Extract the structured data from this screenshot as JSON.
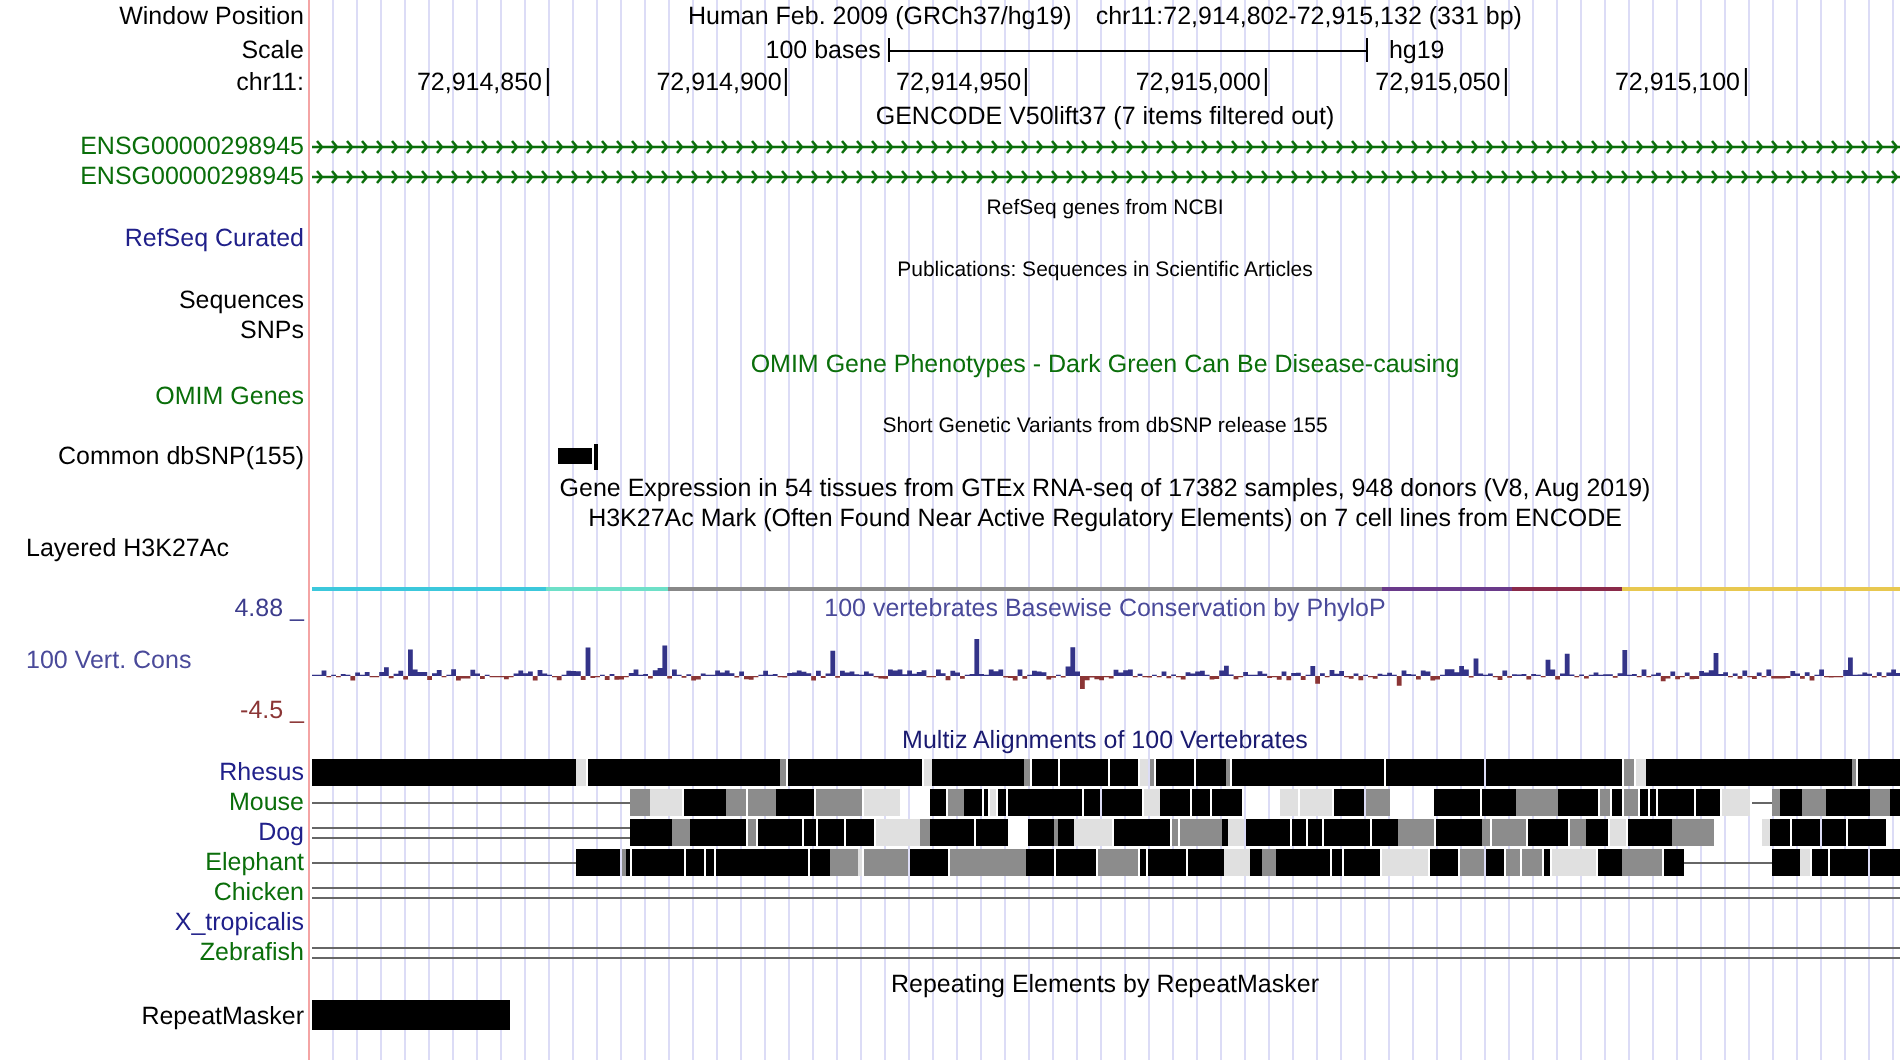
{
  "header": {
    "window_position_label": "Window Position",
    "assembly": "Human Feb. 2009 (GRCh37/hg19)",
    "position": "chr11:72,914,802-72,915,132 (331 bp)",
    "scale_label": "Scale",
    "scale_length": "100 bases",
    "scale_assembly": "hg19",
    "chrom_label": "chr11:",
    "ticks": [
      "72,914,850",
      "72,914,900",
      "72,914,950",
      "72,915,000",
      "72,915,050",
      "72,915,100"
    ]
  },
  "tracks": [
    {
      "kind": "genes",
      "title": "GENCODE V50lift37 (7 items filtered out)",
      "items": [
        {
          "label": "ENSG00000298945",
          "color": "#0a6e0a"
        },
        {
          "label": "ENSG00000298945",
          "color": "#0a6e0a"
        }
      ]
    },
    {
      "kind": "labeled",
      "title": "RefSeq genes from NCBI",
      "labels": [
        "RefSeq Curated"
      ],
      "color": "#20208a"
    },
    {
      "kind": "labeled",
      "title": "Publications: Sequences in Scientific Articles",
      "labels": [
        "Sequences",
        "SNPs"
      ],
      "color": "#000000"
    },
    {
      "kind": "omim",
      "title": "OMIM Gene Phenotypes - Dark Green Can Be Disease-causing",
      "labels": [
        "OMIM Genes"
      ],
      "color": "#0a6e0a"
    },
    {
      "kind": "snps",
      "title": "Short Genetic Variants from dbSNP release 155",
      "labels": [
        "Common dbSNP(155)"
      ]
    },
    {
      "kind": "title",
      "title": "Gene Expression in 54 tissues from GTEx RNA-seq of 17382 samples, 948 donors (V8, Aug 2019)"
    },
    {
      "kind": "signal",
      "title": "H3K27Ac Mark (Often Found Near Active Regulatory Elements) on 7 cell lines from ENCODE",
      "labels": [
        "Layered H3K27Ac"
      ]
    },
    {
      "kind": "conservation",
      "title": "100 vertebrates Basewise Conservation by PhyloP",
      "labels": [
        "100 Vert. Cons"
      ],
      "max": "4.88 _",
      "min": "-4.5 _"
    },
    {
      "kind": "alignment",
      "title": "Multiz Alignments of 100 Vertebrates",
      "species": [
        {
          "name": "Rhesus",
          "color": "#20208a"
        },
        {
          "name": "Mouse",
          "color": "#0a6e0a"
        },
        {
          "name": "Dog",
          "color": "#20208a"
        },
        {
          "name": "Elephant",
          "color": "#0a6e0a"
        },
        {
          "name": "Chicken",
          "color": "#0a6e0a"
        },
        {
          "name": "X_tropicalis",
          "color": "#20208a"
        },
        {
          "name": "Zebrafish",
          "color": "#0a6e0a"
        }
      ]
    },
    {
      "kind": "repeats",
      "title": "Repeating Elements by RepeatMasker",
      "labels": [
        "RepeatMasker"
      ]
    }
  ]
}
